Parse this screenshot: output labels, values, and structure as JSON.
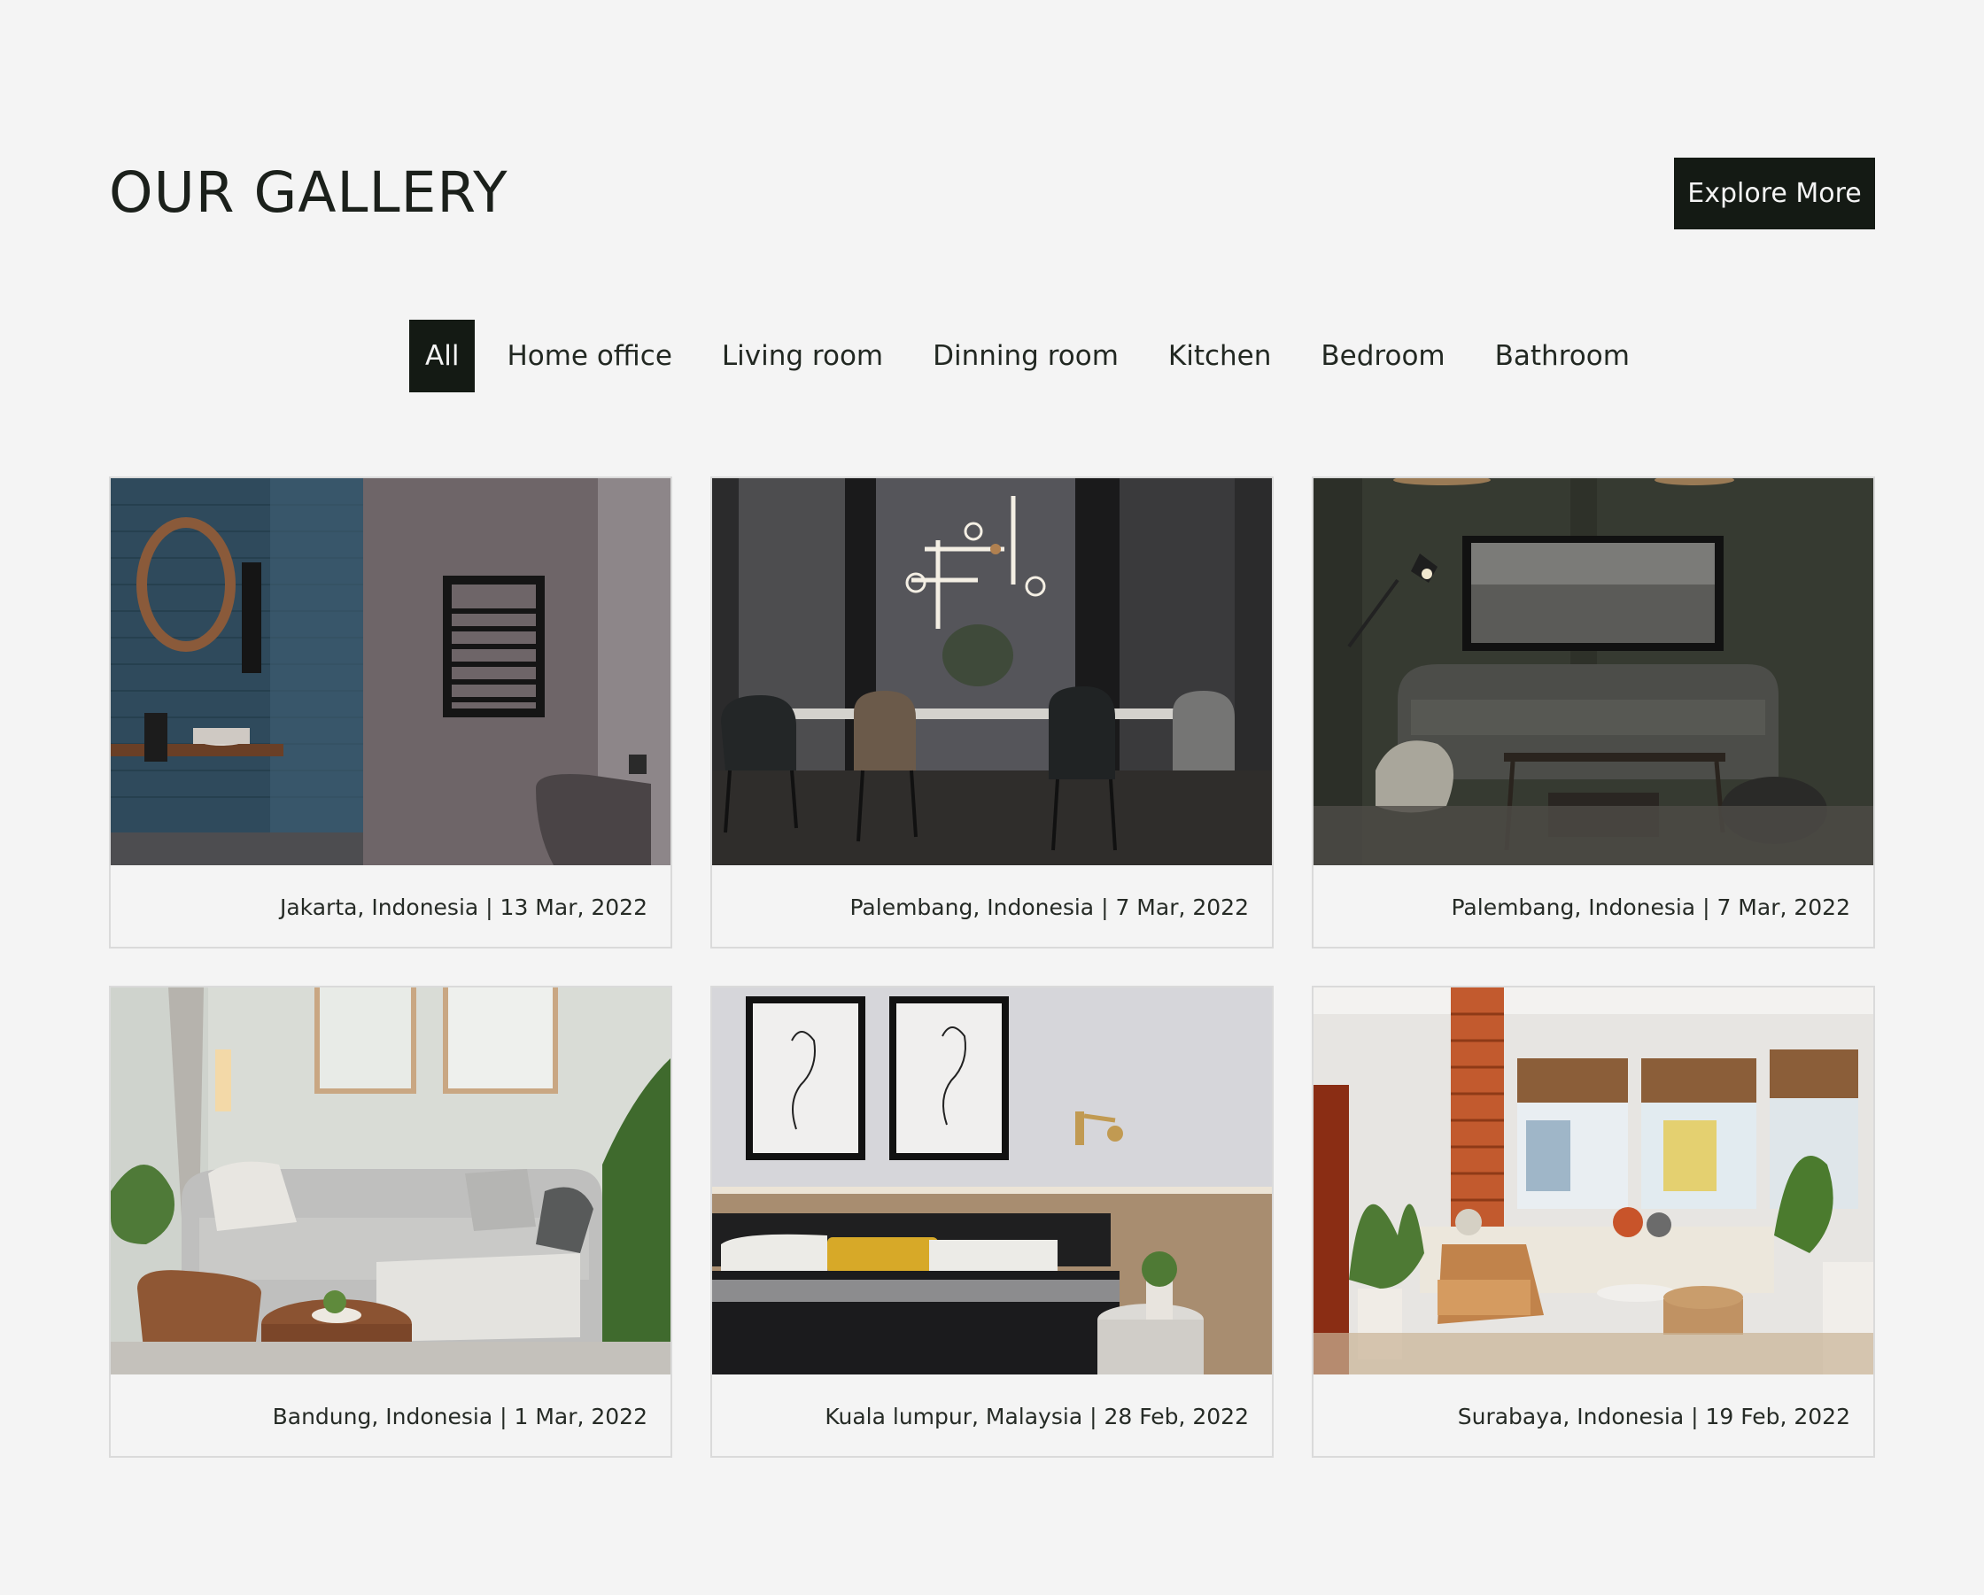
{
  "header": {
    "title": "OUR GALLERY",
    "explore_label": "Explore More"
  },
  "filters": [
    {
      "label": "All",
      "active": true
    },
    {
      "label": "Home office",
      "active": false
    },
    {
      "label": "Living room",
      "active": false
    },
    {
      "label": "Dinning room",
      "active": false
    },
    {
      "label": "Kitchen",
      "active": false
    },
    {
      "label": "Bedroom",
      "active": false
    },
    {
      "label": "Bathroom",
      "active": false
    }
  ],
  "gallery": [
    {
      "image": "bathroom-photo",
      "caption": "Jakarta, Indonesia | 13 Mar, 2022"
    },
    {
      "image": "dining-room-photo",
      "caption": "Palembang, Indonesia | 7 Mar, 2022"
    },
    {
      "image": "dark-living-room-photo",
      "caption": "Palembang, Indonesia | 7 Mar, 2022"
    },
    {
      "image": "bright-living-room-photo",
      "caption": "Bandung, Indonesia | 1 Mar, 2022"
    },
    {
      "image": "bedroom-photo",
      "caption": "Kuala lumpur, Malaysia | 28 Feb, 2022"
    },
    {
      "image": "sunroom-living-photo",
      "caption": "Surabaya, Indonesia | 19 Feb, 2022"
    }
  ],
  "colors": {
    "background": "#f4f4f4",
    "accent": "#141a14",
    "card_border": "#dadada"
  }
}
